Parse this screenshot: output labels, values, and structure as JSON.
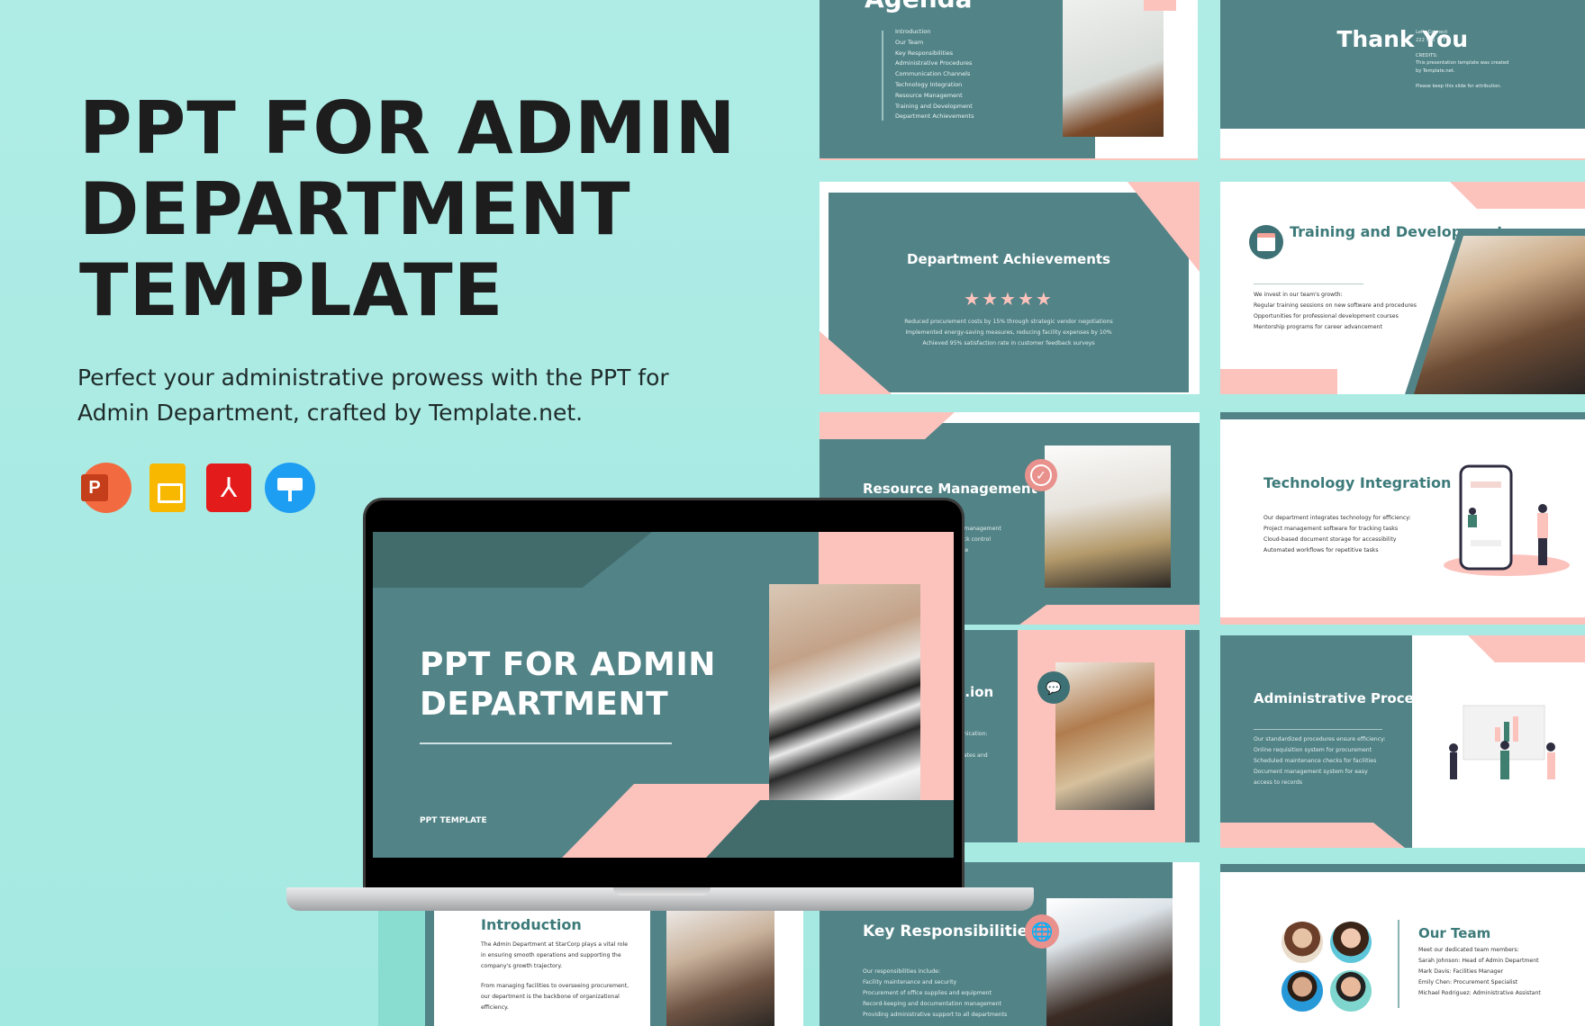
{
  "hero": {
    "title_lines": [
      "PPT FOR ADMIN",
      "DEPARTMENT",
      "TEMPLATE"
    ],
    "subtitle": "Perfect your administrative prowess with the PPT for Admin Department, crafted by Template.net.",
    "app_icons": [
      {
        "name": "powerpoint-icon",
        "glyph": "P",
        "color": "#d24726"
      },
      {
        "name": "google-slides-icon",
        "glyph": "",
        "color": "#f8b800"
      },
      {
        "name": "pdf-icon",
        "glyph": "⅄",
        "color": "#e31b1b"
      },
      {
        "name": "keynote-icon",
        "glyph": "",
        "color": "#1e9ef3"
      }
    ]
  },
  "colors": {
    "background": "#a8ebe3",
    "teal": "#528387",
    "dark_teal": "#426b6b",
    "pink": "#fcc3bd",
    "mint": "#7fc4b7",
    "heading_teal": "#3d7a7a"
  },
  "laptop": {
    "title": "PPT FOR ADMIN DEPARTMENT",
    "tag": "PPT TEMPLATE"
  },
  "slides": {
    "agenda": {
      "title": "Agenda",
      "items": [
        "Introduction",
        "Our Team",
        "Key Responsibilities",
        "Administrative Procedures",
        "Communication Channels",
        "Technology Integration",
        "Resource Management",
        "Training and Development",
        "Department Achievements"
      ]
    },
    "thanks": {
      "title": "Thank You",
      "info": "Let's Connect\n222 555 7777\n\nCREDITS:\nThis presentation template was created\nby Template.net.\n\nPlease keep this slide for attribution."
    },
    "achievements": {
      "title": "Department Achievements",
      "stars": "★★★★★",
      "rating": 5,
      "lines": [
        "Reduced procurement costs by 15% through strategic vendor negotiations",
        "Implemented energy-saving measures, reducing facility expenses by 10%",
        "Achieved 95% satisfaction rate in customer feedback surveys"
      ]
    },
    "training": {
      "title": "Training and Development",
      "lines": [
        "We invest in our team's growth:",
        "Regular training sessions on new software and procedures",
        "Opportunities for professional development courses",
        "Mentorship programs for career advancement"
      ]
    },
    "resource": {
      "title": "Resource Management",
      "lines": [
        "...t management",
        "...ock control",
        "...ste"
      ]
    },
    "communication": {
      "title": "...ion",
      "lines": [
        "...unication:",
        "...n",
        "...dates and"
      ]
    },
    "tech": {
      "title": "Technology Integration",
      "lines": [
        "Our department integrates technology for efficiency:",
        "Project management software for tracking tasks",
        "Cloud-based document storage for accessibility",
        "Automated workflows for repetitive tasks"
      ]
    },
    "admin": {
      "title": "Administrative Procedures",
      "lines": [
        "Our standardized procedures ensure efficiency:",
        "Online requisition system for procurement",
        "Scheduled maintenance checks for facilities",
        "Document management system for easy",
        "access to records"
      ]
    },
    "team": {
      "title": "Our Team",
      "lines": [
        "Meet our dedicated team members:",
        "Sarah Johnson: Head of Admin Department",
        "Mark Davis: Facilities Manager",
        "Emily Chen: Procurement Specialist",
        "Michael Rodriguez: Administrative Assistant"
      ]
    },
    "key": {
      "title": "Key Responsibilities",
      "lines": [
        "Our responsibilities include:",
        "Facility maintenance and security",
        "Procurement of office supplies and equipment",
        "Record-keeping and documentation management",
        "Providing administrative support to all departments"
      ]
    },
    "intro": {
      "title": "Introduction",
      "paragraphs": [
        "The Admin Department at StarCorp plays a vital role in ensuring smooth operations and supporting the company's growth trajectory.",
        "From managing facilities to overseeing procurement, our department is the backbone of organizational efficiency."
      ]
    }
  }
}
